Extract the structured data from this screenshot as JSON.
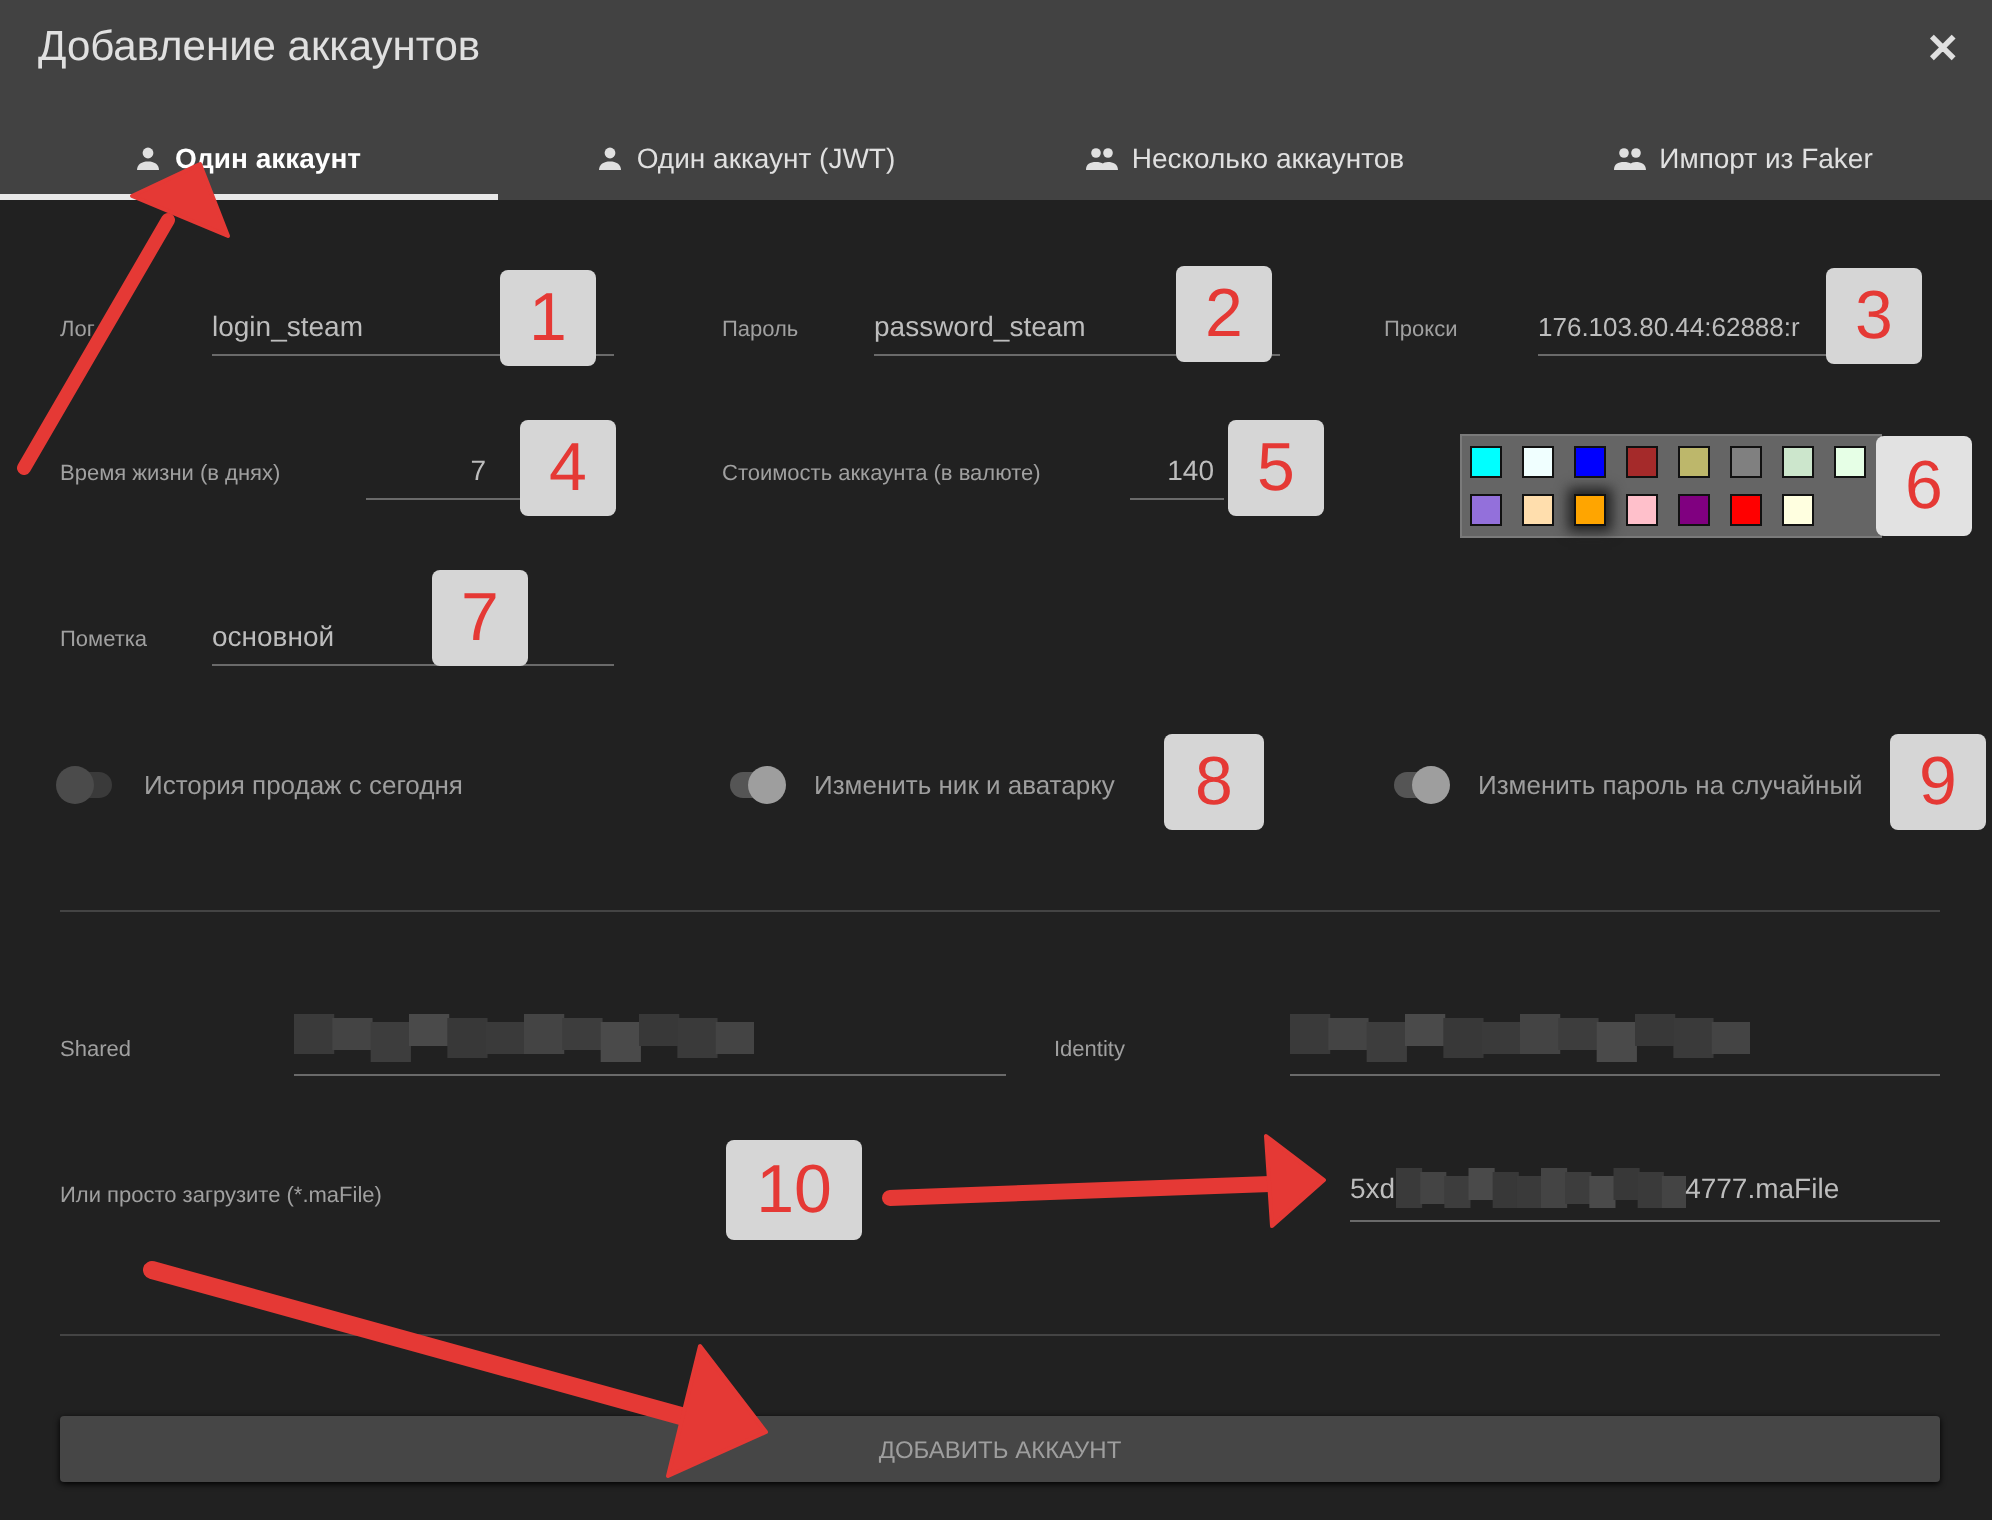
{
  "window": {
    "title": "Добавление аккаунтов",
    "close": "✕"
  },
  "tabs": [
    {
      "label": "Один аккаунт",
      "kind": "single",
      "selected": true
    },
    {
      "label": "Один аккаунт (JWT)",
      "kind": "single",
      "selected": false
    },
    {
      "label": "Несколько аккаунтов",
      "kind": "multiple",
      "selected": false
    },
    {
      "label": "Импорт из Faker",
      "kind": "multiple",
      "selected": false
    }
  ],
  "fields": [
    {
      "label": "Лог",
      "value": "login_steam"
    },
    {
      "label": "Пароль",
      "value": "password_steam"
    },
    {
      "label": "Прокси",
      "value": "176.103.80.44:62888:r"
    },
    {
      "label": "Время жизни (в днях)",
      "value": "7"
    },
    {
      "label": "Стоимость аккаунта (в валюте)",
      "value": "140"
    },
    {
      "label": "Пометка",
      "value": "основной"
    }
  ],
  "colors": [
    {
      "color": "#00ffff",
      "selected": false
    },
    {
      "color": "#f0ffff",
      "selected": false
    },
    {
      "color": "#0000ff",
      "selected": false
    },
    {
      "color": "#a52a2a",
      "selected": false
    },
    {
      "color": "#bdb76b",
      "selected": false
    },
    {
      "color": "#808080",
      "selected": false
    },
    {
      "color": "#cce6cc",
      "selected": false
    },
    {
      "color": "#e6ffe6",
      "selected": false
    },
    {
      "color": "#9370db",
      "selected": false
    },
    {
      "color": "#ffdead",
      "selected": false
    },
    {
      "color": "#ffa500",
      "selected": true
    },
    {
      "color": "#ffc0cb",
      "selected": false
    },
    {
      "color": "#800080",
      "selected": false
    },
    {
      "color": "#ff0000",
      "selected": false
    },
    {
      "color": "#ffffe0",
      "selected": false
    }
  ],
  "toggles": [
    {
      "label": "История продаж с сегодня",
      "on": false
    },
    {
      "label": "Изменить ник и аватарку",
      "on": true
    },
    {
      "label": "Изменить пароль на случайный",
      "on": true
    }
  ],
  "secrets": [
    {
      "label": "Shared"
    },
    {
      "label": "Identity"
    }
  ],
  "mafile": {
    "label": "Или просто загрузите (*.maFile)",
    "value_start": "5xd",
    "value_end": "4777.maFile"
  },
  "submit": "ДОБАВИТЬ АККАУНТ",
  "badges": [
    "1",
    "2",
    "3",
    "4",
    "5",
    "6",
    "7",
    "8",
    "9",
    "10"
  ]
}
